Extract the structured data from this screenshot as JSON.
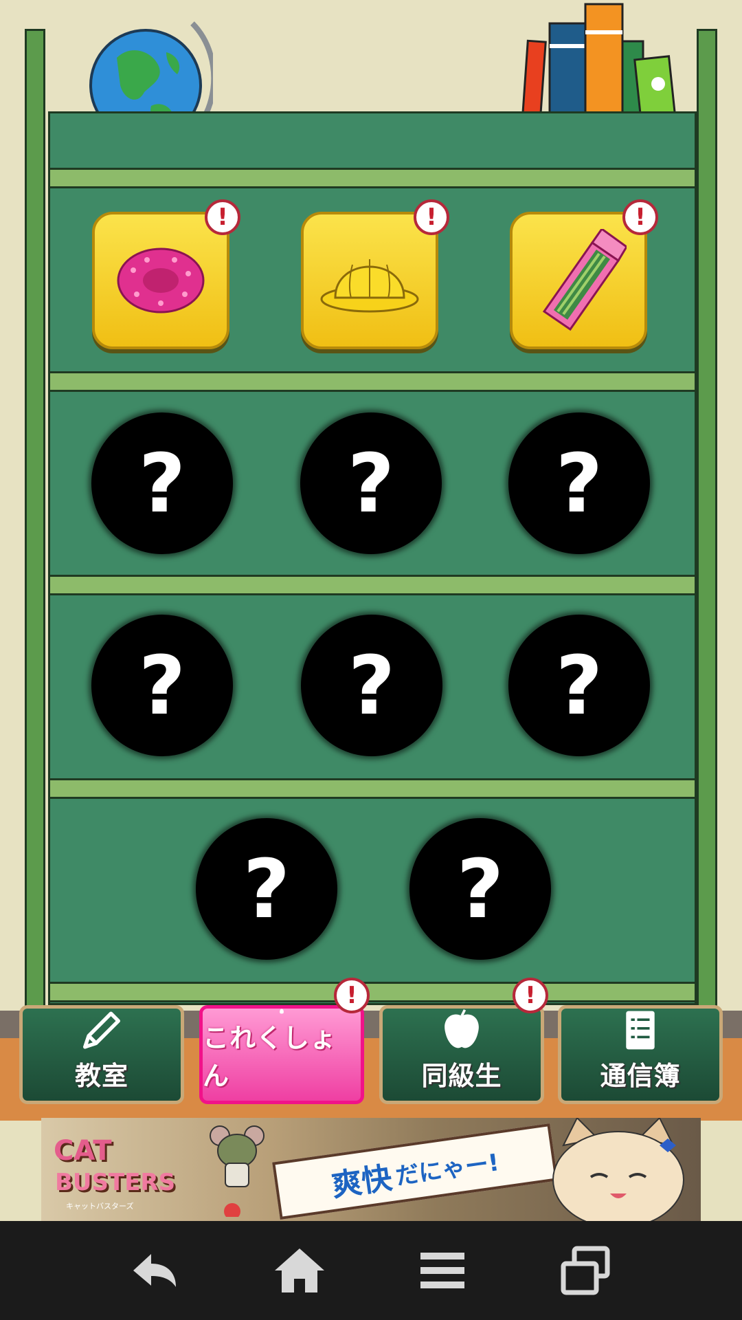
{
  "collection": {
    "items": [
      {
        "name": "scrunchie",
        "unlocked": true,
        "has_alert": true,
        "badge": "!"
      },
      {
        "name": "school-hat",
        "unlocked": true,
        "has_alert": true,
        "badge": "!"
      },
      {
        "name": "pencil-case",
        "unlocked": true,
        "has_alert": true,
        "badge": "!"
      },
      {
        "unlocked": false,
        "label": "?"
      },
      {
        "unlocked": false,
        "label": "?"
      },
      {
        "unlocked": false,
        "label": "?"
      },
      {
        "unlocked": false,
        "label": "?"
      },
      {
        "unlocked": false,
        "label": "?"
      },
      {
        "unlocked": false,
        "label": "?"
      },
      {
        "unlocked": false,
        "label": "?"
      },
      {
        "unlocked": false,
        "label": "?"
      }
    ]
  },
  "nav": {
    "tabs": [
      {
        "label": "教室",
        "icon": "pencil-icon",
        "active": false,
        "badge": ""
      },
      {
        "label": "これくしょん",
        "icon": "egg-icon",
        "active": true,
        "badge": "!"
      },
      {
        "label": "同級生",
        "icon": "apple-icon",
        "active": false,
        "badge": "!"
      },
      {
        "label": "通信簿",
        "icon": "report-card-icon",
        "active": false,
        "badge": ""
      }
    ]
  },
  "ad": {
    "logo_line1": "CAT",
    "logo_line2": "BUSTERS",
    "logo_sub": "キャットバスターズ",
    "catch_main": "爽快",
    "catch_rest": "だにゃー!"
  },
  "system_bar": {
    "buttons": [
      "back-icon",
      "home-icon",
      "menu-icon",
      "recent-apps-icon"
    ]
  },
  "colors": {
    "shelf_back": "#3f8a66",
    "tile_yellow": "#f5d21e",
    "active_tab": "#ef3fa2",
    "alert_red": "#c71f2f"
  }
}
